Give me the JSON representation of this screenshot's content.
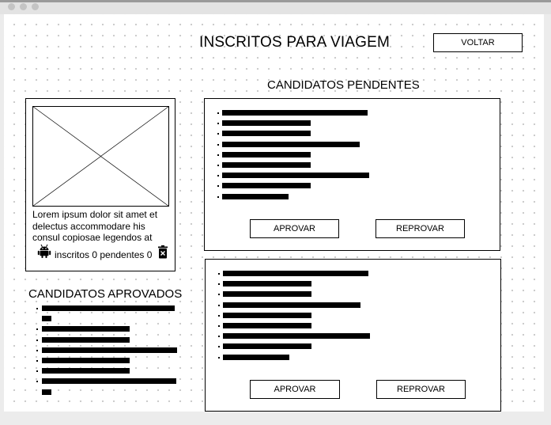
{
  "page": {
    "title": "INSCRITOS PARA VIAGEM",
    "back_label": "VOLTAR"
  },
  "sections": {
    "pending_title": "CANDIDATOS PENDENTES",
    "approved_title": "CANDIDATOS APROVADOS"
  },
  "profile": {
    "image_icon": "image-placeholder-icon",
    "description": "Lorem ipsum dolor sit amet et delectus accommodare his consul copiosae legendos at",
    "android_icon": "android-icon",
    "stats_text": "inscritos 0 pendentes 0",
    "delete_icon": "trash-icon"
  },
  "pending_cards": [
    {
      "approve_label": "APROVAR",
      "reject_label": "REPROVAR",
      "items": [
        {
          "length": 0.92
        },
        {
          "length": 0.56
        },
        {
          "length": 0.56
        },
        {
          "length": 0.87
        },
        {
          "length": 0.56
        },
        {
          "length": 0.56
        },
        {
          "length": 0.93
        },
        {
          "length": 0.56
        },
        {
          "length": 0.42
        }
      ]
    },
    {
      "approve_label": "APROVAR",
      "reject_label": "REPROVAR",
      "items": [
        {
          "length": 0.92
        },
        {
          "length": 0.56
        },
        {
          "length": 0.56
        },
        {
          "length": 0.87
        },
        {
          "length": 0.56
        },
        {
          "length": 0.56
        },
        {
          "length": 0.93
        },
        {
          "length": 0.56
        },
        {
          "length": 0.42
        }
      ]
    }
  ],
  "approved_list": {
    "items": [
      {
        "length": 0.97,
        "wrap_length": 0.07
      },
      {
        "length": 0.64
      },
      {
        "length": 0.64
      },
      {
        "length": 0.99
      },
      {
        "length": 0.64
      },
      {
        "length": 0.64
      },
      {
        "length": 0.98,
        "wrap_length": 0.07
      }
    ]
  }
}
